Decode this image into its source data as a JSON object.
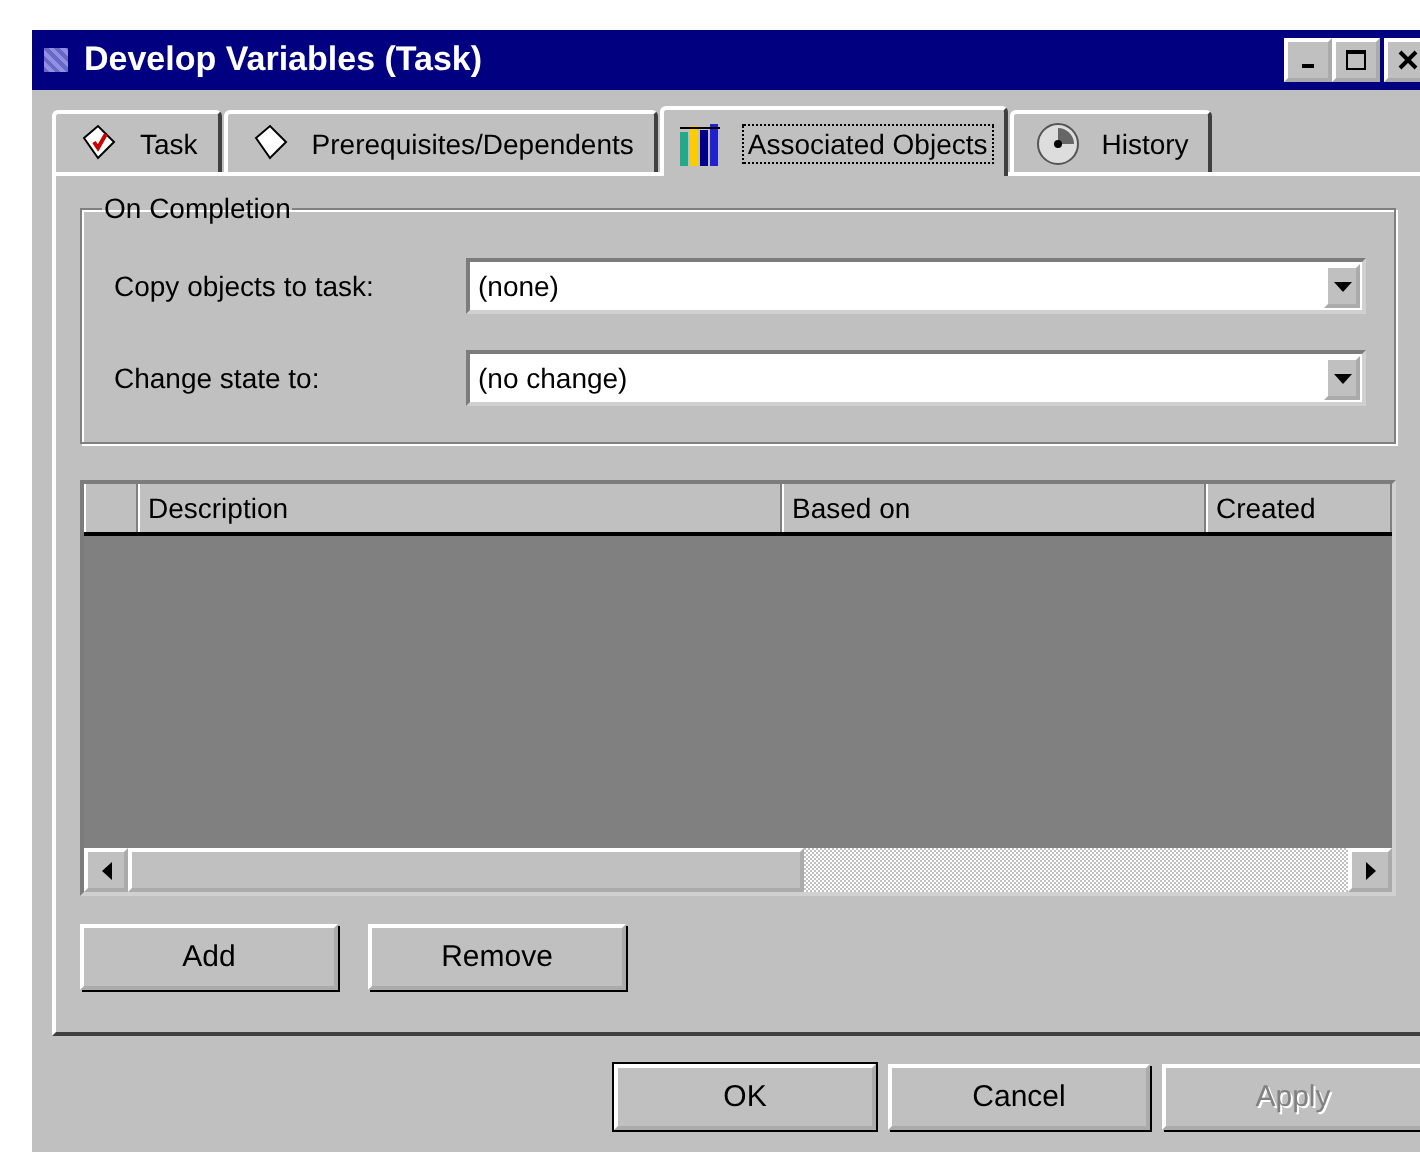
{
  "window": {
    "title": "Develop Variables (Task)"
  },
  "tabs": [
    {
      "label": "Task",
      "selected": false
    },
    {
      "label": "Prerequisites/Dependents",
      "selected": false
    },
    {
      "label": "Associated Objects",
      "selected": true
    },
    {
      "label": "History",
      "selected": false
    }
  ],
  "group": {
    "title": "On Completion",
    "fields": [
      {
        "label": "Copy objects to task:",
        "value": "(none)"
      },
      {
        "label": "Change state to:",
        "value": "(no change)"
      }
    ]
  },
  "table": {
    "columns": [
      "Description",
      "Based on",
      "Created"
    ]
  },
  "list_buttons": [
    {
      "label": "Add"
    },
    {
      "label": "Remove"
    }
  ],
  "buttons": [
    {
      "label": "OK",
      "default": true,
      "disabled": false
    },
    {
      "label": "Cancel",
      "default": false,
      "disabled": false
    },
    {
      "label": "Apply",
      "default": false,
      "disabled": true
    }
  ]
}
